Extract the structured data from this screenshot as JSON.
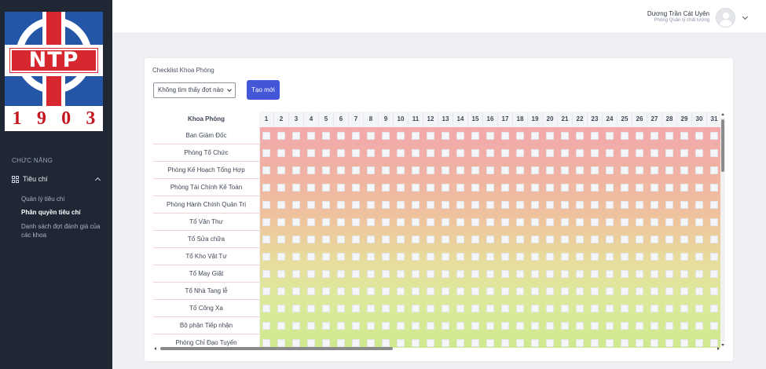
{
  "logo": {
    "text": "NTP",
    "year": [
      "1",
      "9",
      "0",
      "3"
    ]
  },
  "sidebar": {
    "section_label": "CHỨC NĂNG",
    "group": {
      "label": "Tiêu chí",
      "icon": "grid-icon",
      "expanded": true
    },
    "items": [
      {
        "label": "Quản lý tiêu chí",
        "active": false
      },
      {
        "label": "Phân quyền tiêu chí",
        "active": true
      },
      {
        "label": "Danh sách đợt đánh giá của các khoa",
        "active": false
      }
    ]
  },
  "header": {
    "user_name": "Dương Trần Cát Uyên",
    "user_role": "Phòng Quản lý chất lượng"
  },
  "card": {
    "title": "Checklist Khoa Phòng",
    "select_value": "Không tìm thấy đợt nào",
    "new_button": "Tạo mới"
  },
  "table": {
    "header_label": "Khoa Phòng",
    "days": [
      "1",
      "2",
      "3",
      "4",
      "5",
      "6",
      "7",
      "8",
      "9",
      "10",
      "11",
      "12",
      "13",
      "14",
      "15",
      "16",
      "17",
      "18",
      "19",
      "20",
      "21",
      "22",
      "23",
      "24",
      "25",
      "26",
      "27",
      "28",
      "29",
      "30",
      "31"
    ],
    "rows": [
      "Ban Giám Đốc",
      "Phòng Tổ Chức",
      "Phòng Kế Hoạch Tổng Hợp",
      "Phòng Tài Chính Kế Toán",
      "Phòng Hành Chính Quản Trị",
      "Tổ Văn Thư",
      "Tổ Sửa chữa",
      "Tổ Kho Vật Tư",
      "Tổ May Giặt",
      "Tổ Nhà Tang lễ",
      "Tổ Công Xa",
      "Bộ phận Tiếp nhận",
      "Phòng Chỉ Đạo Tuyến"
    ]
  },
  "colors": {
    "accent": "#4456d8",
    "sidebar": "#1f2734"
  }
}
